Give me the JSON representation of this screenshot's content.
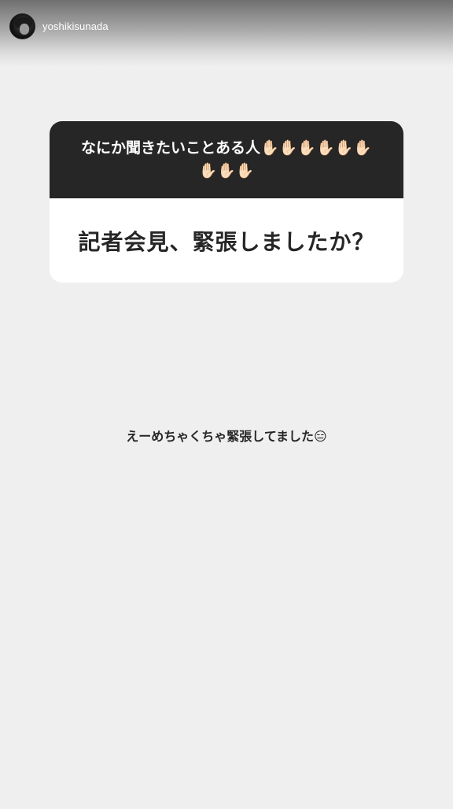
{
  "header": {
    "username": "yoshikisunada"
  },
  "question_sticker": {
    "prompt": "なにか聞きたいことある人✋🏻✋🏻✋🏻✋🏻✋🏻✋🏻✋🏻✋🏻✋🏻",
    "question": "記者会見、緊張しましたか？"
  },
  "reply": {
    "text": "えーめちゃくちゃ緊張してました😑"
  }
}
